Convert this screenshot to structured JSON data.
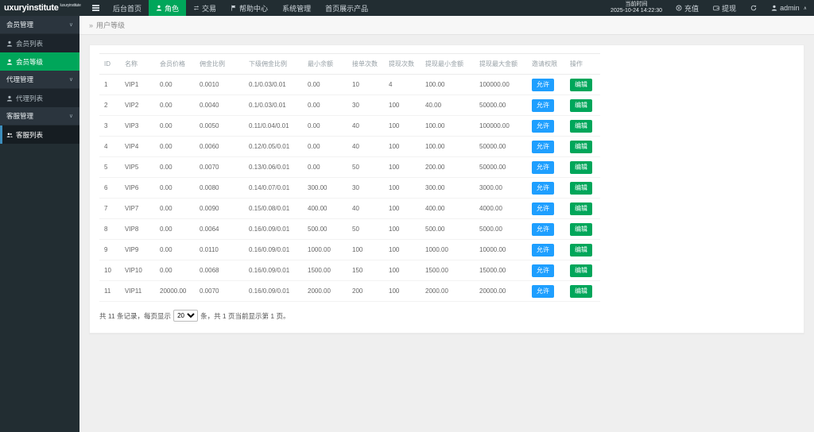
{
  "navbar": {
    "logo": "uxuryinstitute",
    "logo_sup": "luxuryinstitute",
    "items": [
      {
        "label": "后台首页"
      },
      {
        "label": "角色"
      },
      {
        "label": "交易"
      },
      {
        "label": "帮助中心"
      },
      {
        "label": "系统管理"
      },
      {
        "label": "首页展示产品"
      }
    ],
    "time_label": "当前时间",
    "time_value": "2025-10-24 14:22:30",
    "recharge": "充值",
    "withdraw": "提现",
    "user": "admin"
  },
  "sidebar": {
    "items": [
      {
        "label": "会员管理"
      },
      {
        "label": "会员列表"
      },
      {
        "label": "会员等级"
      },
      {
        "label": "代理管理"
      },
      {
        "label": "代理列表"
      },
      {
        "label": "客服管理"
      },
      {
        "label": "客服列表"
      }
    ]
  },
  "breadcrumb": "用户等级",
  "table": {
    "headers": [
      "ID",
      "名称",
      "会员价格",
      "佣金比例",
      "下级佣金比例",
      "最小余额",
      "接单次数",
      "提现次数",
      "提现最小金额",
      "提现最大金额",
      "邀请权限",
      "操作"
    ],
    "allow_label": "允许",
    "edit_label": "编辑",
    "rows": [
      [
        "1",
        "VIP1",
        "0.00",
        "0.0010",
        "0.1/0.03/0.01",
        "0.00",
        "10",
        "4",
        "100.00",
        "100000.00"
      ],
      [
        "2",
        "VIP2",
        "0.00",
        "0.0040",
        "0.1/0.03/0.01",
        "0.00",
        "30",
        "100",
        "40.00",
        "50000.00"
      ],
      [
        "3",
        "VIP3",
        "0.00",
        "0.0050",
        "0.11/0.04/0.01",
        "0.00",
        "40",
        "100",
        "100.00",
        "100000.00"
      ],
      [
        "4",
        "VIP4",
        "0.00",
        "0.0060",
        "0.12/0.05/0.01",
        "0.00",
        "40",
        "100",
        "100.00",
        "50000.00"
      ],
      [
        "5",
        "VIP5",
        "0.00",
        "0.0070",
        "0.13/0.06/0.01",
        "0.00",
        "50",
        "100",
        "200.00",
        "50000.00"
      ],
      [
        "6",
        "VIP6",
        "0.00",
        "0.0080",
        "0.14/0.07/0.01",
        "300.00",
        "30",
        "100",
        "300.00",
        "3000.00"
      ],
      [
        "7",
        "VIP7",
        "0.00",
        "0.0090",
        "0.15/0.08/0.01",
        "400.00",
        "40",
        "100",
        "400.00",
        "4000.00"
      ],
      [
        "8",
        "VIP8",
        "0.00",
        "0.0064",
        "0.16/0.09/0.01",
        "500.00",
        "50",
        "100",
        "500.00",
        "5000.00"
      ],
      [
        "9",
        "VIP9",
        "0.00",
        "0.0110",
        "0.16/0.09/0.01",
        "1000.00",
        "100",
        "100",
        "1000.00",
        "10000.00"
      ],
      [
        "10",
        "VIP10",
        "0.00",
        "0.0068",
        "0.16/0.09/0.01",
        "1500.00",
        "150",
        "100",
        "1500.00",
        "15000.00"
      ],
      [
        "11",
        "VIP11",
        "20000.00",
        "0.0070",
        "0.16/0.09/0.01",
        "2000.00",
        "200",
        "100",
        "2000.00",
        "20000.00"
      ]
    ]
  },
  "pagination": {
    "prefix": "共 11 条记录，每页显示",
    "page_size": "20",
    "suffix": "条，共 1 页当前显示第 1 页。"
  },
  "colors": {
    "accent_green": "#00a65a",
    "accent_blue": "#1e9fff",
    "dark": "#222d32"
  }
}
